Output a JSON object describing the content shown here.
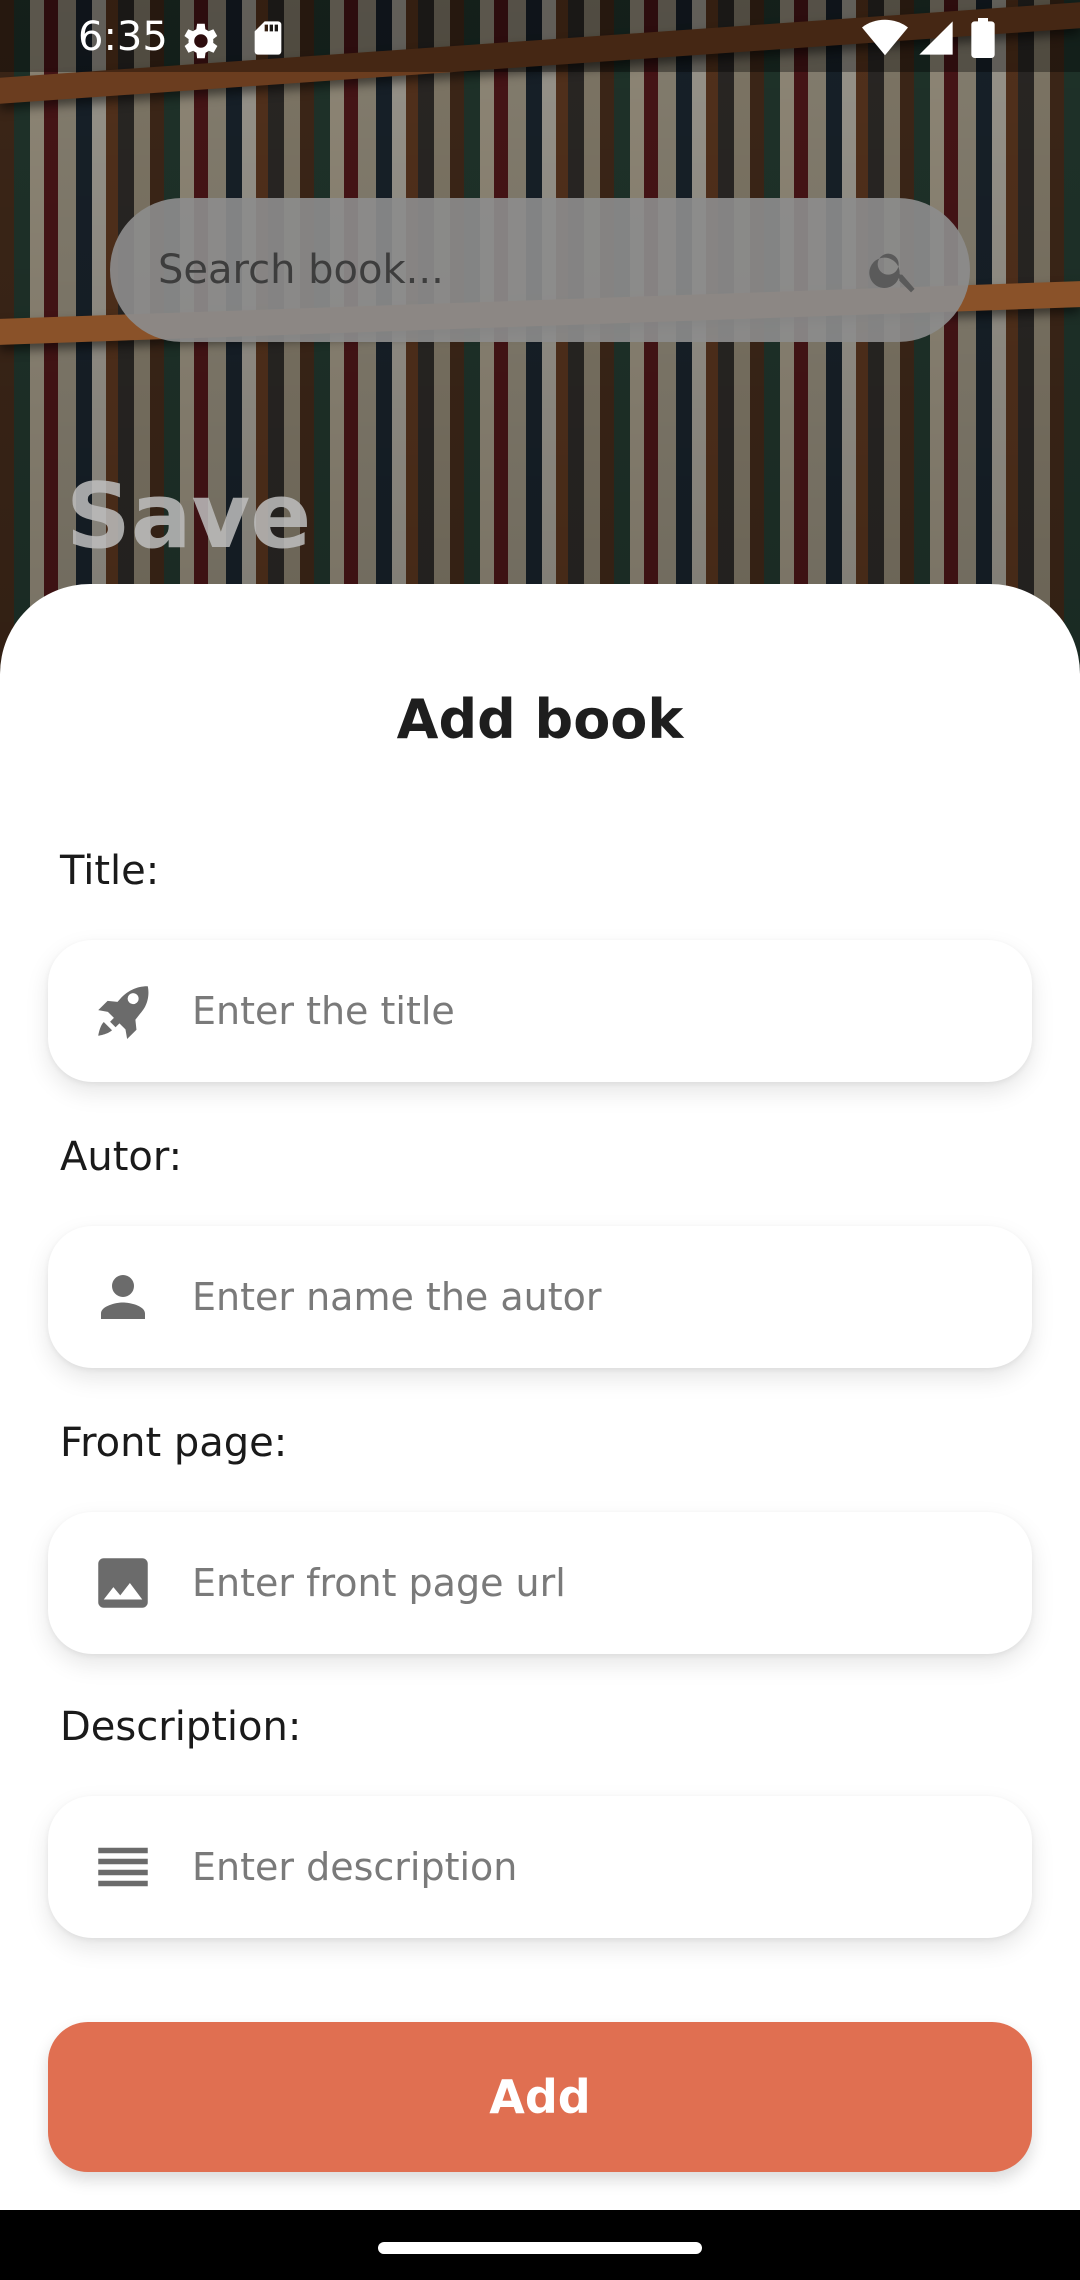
{
  "status_bar": {
    "time": "6:35",
    "icons": [
      "settings-icon",
      "sd-card-icon",
      "wifi-icon",
      "signal-icon",
      "battery-icon"
    ]
  },
  "search": {
    "placeholder": "Search book...",
    "icon": "search-icon"
  },
  "background_title": "Save",
  "sheet": {
    "title": "Add book",
    "fields": [
      {
        "label": "Title:",
        "placeholder": "Enter the title",
        "icon": "rocket-icon"
      },
      {
        "label": "Autor:",
        "placeholder": "Enter name the autor",
        "icon": "person-icon"
      },
      {
        "label": "Front page:",
        "placeholder": "Enter front page url",
        "icon": "image-icon"
      },
      {
        "label": "Description:",
        "placeholder": "Enter description",
        "icon": "notes-icon"
      }
    ],
    "submit_label": "Add"
  },
  "colors": {
    "accent": "#e06f51",
    "sheet_background": "#ffffff",
    "search_background": "#8c8c8c"
  }
}
